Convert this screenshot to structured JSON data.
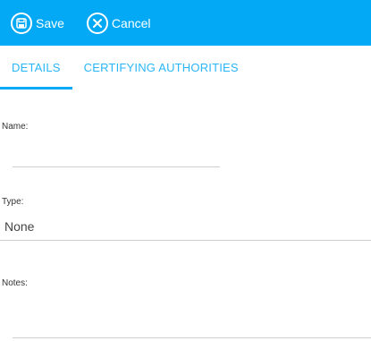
{
  "toolbar": {
    "save_label": "Save",
    "cancel_label": "Cancel",
    "background_color": "#03a9f4"
  },
  "tabs": [
    {
      "label": "DETAILS",
      "active": true
    },
    {
      "label": "CERTIFYING AUTHORITIES",
      "active": false
    }
  ],
  "form": {
    "name": {
      "label": "Name:",
      "value": ""
    },
    "type": {
      "label": "Type:",
      "value": "None"
    },
    "notes": {
      "label": "Notes:",
      "value": ""
    }
  },
  "icons": {
    "save": "save-icon",
    "cancel": "cancel-icon"
  }
}
